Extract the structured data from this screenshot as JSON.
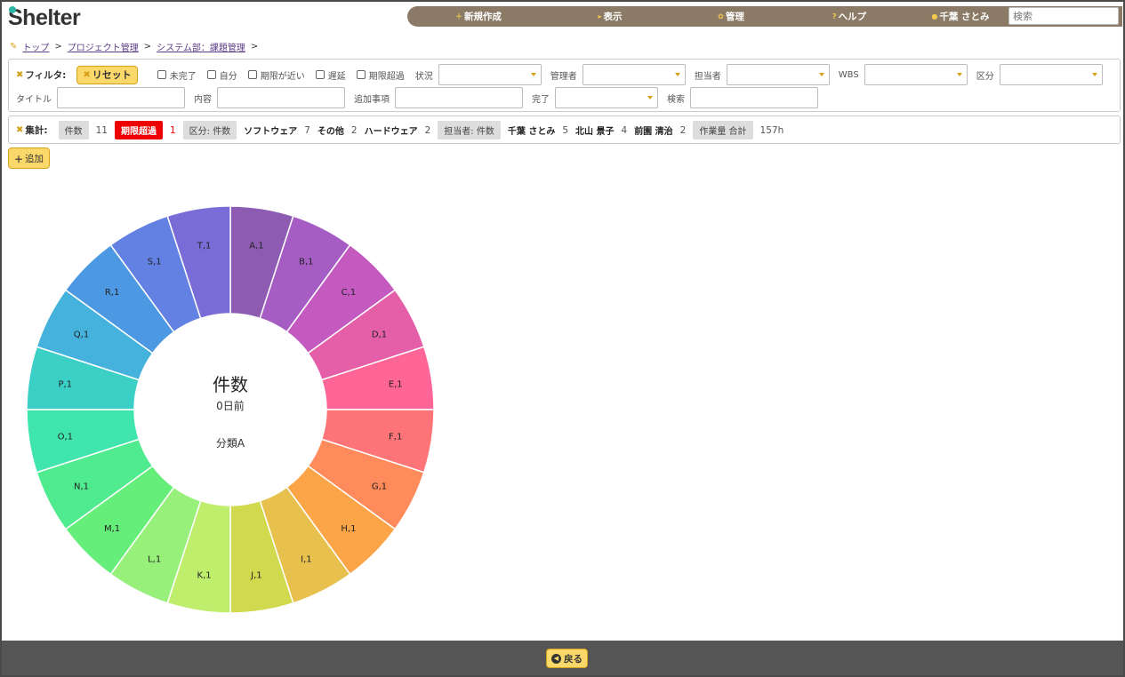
{
  "app": {
    "logo": "Shelter"
  },
  "nav": {
    "items": [
      {
        "label": "新規作成",
        "icon": "plus-icon"
      },
      {
        "label": "表示",
        "icon": "triangle-right-icon"
      },
      {
        "label": "管理",
        "icon": "gear-icon"
      },
      {
        "label": "ヘルプ",
        "icon": "question-icon"
      },
      {
        "label": "千葉 さとみ",
        "icon": "user-icon"
      }
    ],
    "search_placeholder": "検索"
  },
  "breadcrumb": {
    "items": [
      "トップ",
      "プロジェクト管理",
      "システム部：課題管理"
    ],
    "separator": ">"
  },
  "filter": {
    "label": "フィルタ:",
    "reset": "リセット",
    "checkboxes": [
      "未完了",
      "自分",
      "期限が近い",
      "遅延",
      "期限超過"
    ],
    "status": "状況",
    "manager": "管理者",
    "assignee": "担当者",
    "wbs": "WBS",
    "category": "区分",
    "title": "タイトル",
    "content": "内容",
    "extra": "追加事項",
    "done": "完了",
    "search": "検索"
  },
  "summary": {
    "label": "集計:",
    "count_chip": "件数",
    "count_value": "11",
    "overdue_chip": "期限超過",
    "overdue_value": "1",
    "category_chip": "区分: 件数",
    "categories": [
      {
        "name": "ソフトウェア",
        "value": "7"
      },
      {
        "name": "その他",
        "value": "2"
      },
      {
        "name": "ハードウェア",
        "value": "2"
      }
    ],
    "assignee_chip": "担当者: 件数",
    "assignees": [
      {
        "name": "千葉 さとみ",
        "value": "5"
      },
      {
        "name": "北山 景子",
        "value": "4"
      },
      {
        "name": "前園 清治",
        "value": "2"
      }
    ],
    "hours_chip": "作業量 合計",
    "hours_value": "157h"
  },
  "add_button": "追加",
  "chart_data": {
    "type": "pie",
    "donut": true,
    "center_title": "件数",
    "center_subtitle": "0日前",
    "center_caption": "分類A",
    "labels": [
      "A",
      "B",
      "C",
      "D",
      "E",
      "F",
      "G",
      "H",
      "I",
      "J",
      "K",
      "L",
      "M",
      "N",
      "O",
      "P",
      "Q",
      "R",
      "S",
      "T"
    ],
    "values": [
      1,
      1,
      1,
      1,
      1,
      1,
      1,
      1,
      1,
      1,
      1,
      1,
      1,
      1,
      1,
      1,
      1,
      1,
      1,
      1
    ],
    "colors": [
      "#8e5bb3",
      "#a55cc3",
      "#c45ac0",
      "#e45fa8",
      "#ff6596",
      "#ff7478",
      "#ff8a5c",
      "#fca548",
      "#e7c04d",
      "#d1d94f",
      "#bfee6c",
      "#96f07a",
      "#66ee7a",
      "#50ea8f",
      "#3fe5ad",
      "#3ccfc6",
      "#45b2de",
      "#4d98e2",
      "#6381e3",
      "#7a6cd6"
    ]
  },
  "footer": {
    "back": "戻る"
  }
}
